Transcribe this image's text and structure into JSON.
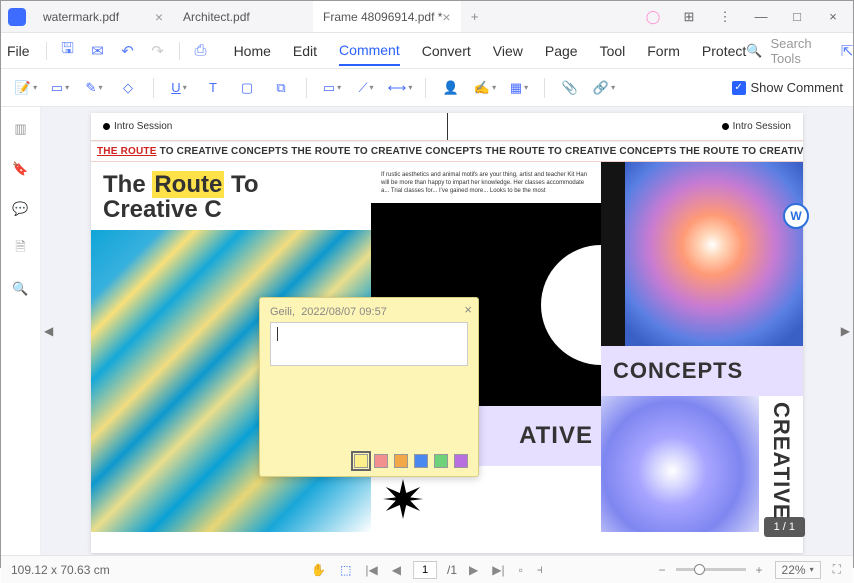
{
  "tabs": [
    {
      "label": "watermark.pdf"
    },
    {
      "label": "Architect.pdf"
    },
    {
      "label": "Frame 48096914.pdf *"
    }
  ],
  "menu": {
    "file": "File",
    "items": [
      "Home",
      "Edit",
      "Comment",
      "Convert",
      "View",
      "Page",
      "Tool",
      "Form",
      "Protect"
    ],
    "active": "Comment",
    "search_placeholder": "Search Tools"
  },
  "toolbar": {
    "show_comment": "Show Comment"
  },
  "doc": {
    "intro_left": "Intro Session",
    "intro_right": "Intro Session",
    "marquee_prefix": "THE ROUTE",
    "marquee_rest": " TO CREATIVE CONCEPTS THE ROUTE TO CREATIVE CONCEPTS THE ROUTE TO CREATIVE CONCEPTS THE ROUTE TO CREATIVE CONCEPTS THE R",
    "heading_pre": "The ",
    "heading_hl": "Route",
    "heading_post": " To",
    "heading_line2": "Creative C",
    "tiny": "If rustic aesthetics and animal motifs are your thing, artist and teacher Kit Han will be more than happy to impart her knowledge. Her classes accommodate a... Trial classes for... I've gained more... Looks to be the most",
    "ative": "ATIVE",
    "concepts": "CONCEPTS",
    "creative": "CREATIVE"
  },
  "note": {
    "author": "Geili,",
    "timestamp": "2022/08/07 09:57",
    "value": "",
    "colors": [
      "#fdf08a",
      "#f29090",
      "#f2a848",
      "#4a88f0",
      "#6fd27a",
      "#b86fe0"
    ]
  },
  "page_badge": "1 / 1",
  "word_badge": "W",
  "status": {
    "dims": "109.12 x 70.63 cm",
    "page_current": "1",
    "page_total": "/1",
    "zoom": "22%"
  }
}
